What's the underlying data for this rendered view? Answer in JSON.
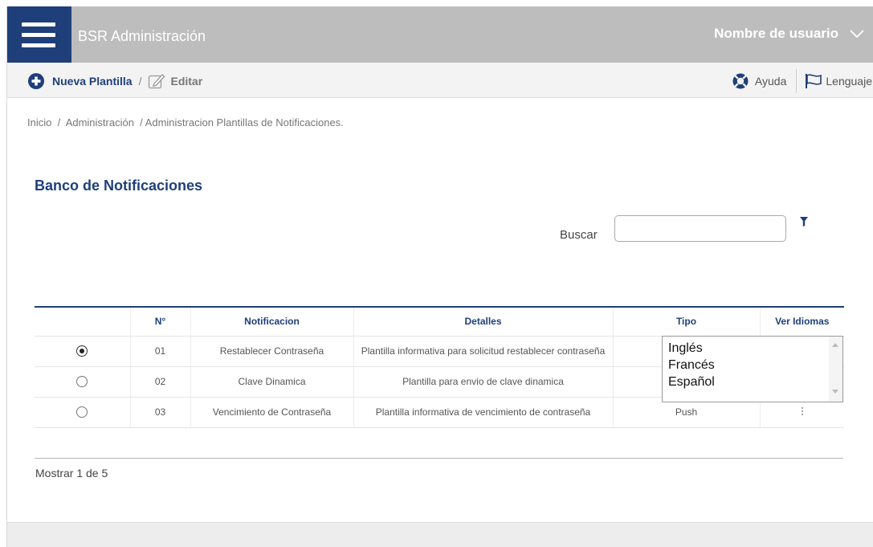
{
  "header": {
    "app_title": "BSR Administración",
    "user_name": "Nombre de usuario",
    "menu_icon": "hamburger-icon",
    "user_chevron_icon": "chevron-down-icon"
  },
  "toolbar": {
    "new_label": "Nueva Plantilla",
    "separator": "/",
    "edit_label": "Editar",
    "help_label": "Ayuda",
    "language_label": "Lenguaje"
  },
  "breadcrumb": "Inicio  /  Administración  / Administracion Plantillas de Notificaciones.",
  "page_title": "Banco de Notificaciones",
  "search": {
    "label": "Buscar",
    "value": "",
    "placeholder": ""
  },
  "table": {
    "headers": [
      "",
      "N°",
      "Notificacion",
      "Detalles",
      "Tipo",
      "Ver Idiomas"
    ],
    "rows": [
      {
        "selected": true,
        "num": "01",
        "name": "Restablecer Contraseña",
        "details": "Plantilla informativa para solicitud restablecer contraseña",
        "type": ""
      },
      {
        "selected": false,
        "num": "02",
        "name": "Clave Dinamica",
        "details": "Plantilla para envio de clave dinamica",
        "type": ""
      },
      {
        "selected": false,
        "num": "03",
        "name": "Vencimiento de Contraseña",
        "details": "Plantilla informativa de vencimiento de contraseña",
        "type": "Push"
      }
    ]
  },
  "languages": [
    "Inglés",
    "Francés",
    "Español"
  ],
  "pager": "Mostrar 1 de 5",
  "colors": {
    "brand_blue": "#1f3f7a",
    "header_gray": "#bdbdbd",
    "toolbar_gray": "#f3f3f3"
  }
}
